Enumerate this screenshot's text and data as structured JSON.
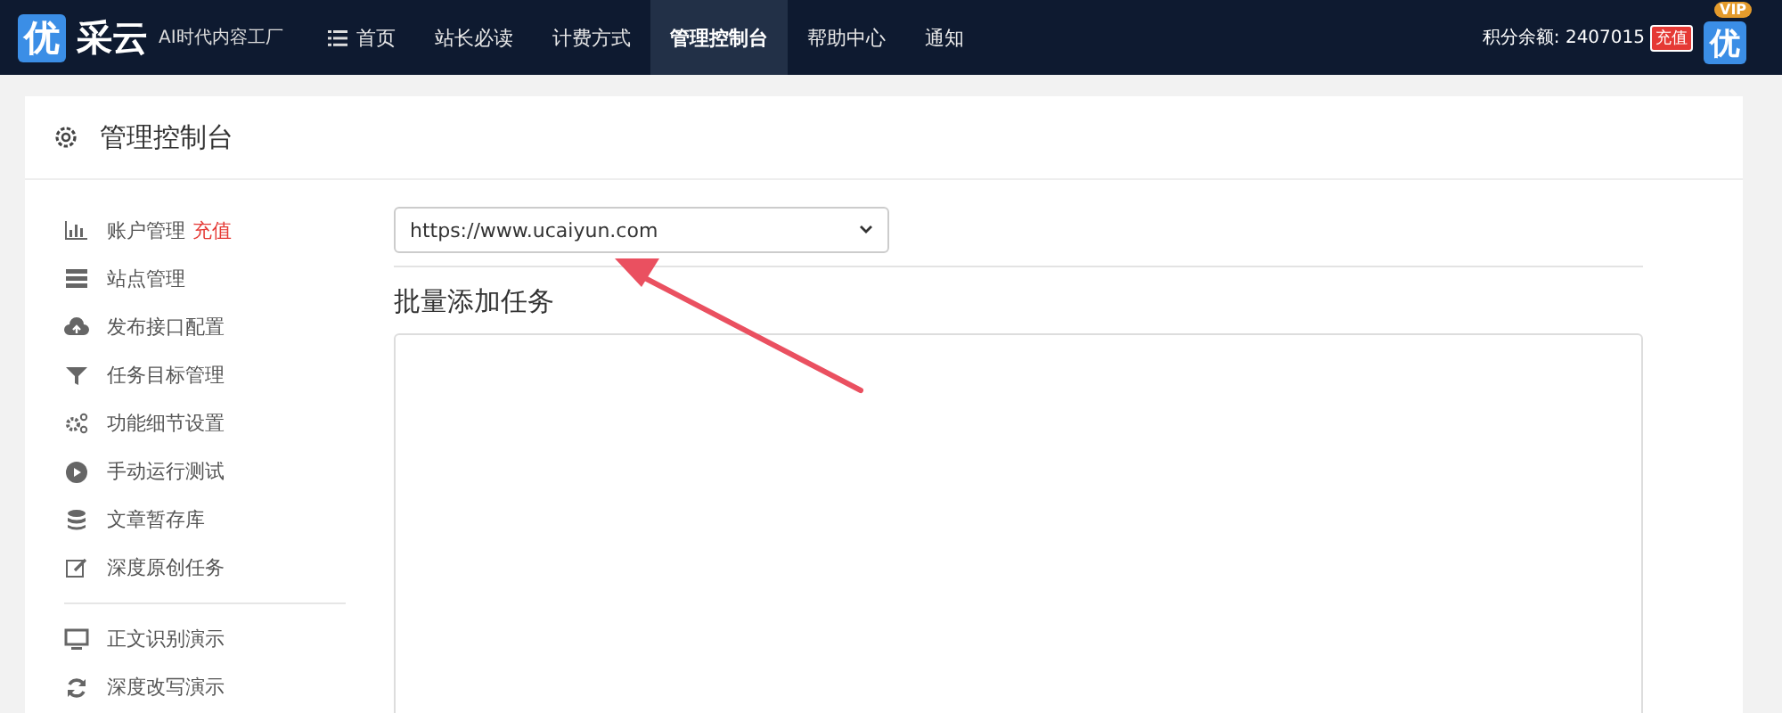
{
  "navbar": {
    "logo_mark": "优",
    "logo_text": "采云",
    "tagline": "AI时代内容工厂",
    "items": [
      {
        "label": "首页",
        "selected": false
      },
      {
        "label": "站长必读",
        "selected": false
      },
      {
        "label": "计费方式",
        "selected": false
      },
      {
        "label": "管理控制台",
        "selected": true
      },
      {
        "label": "帮助中心",
        "selected": false
      },
      {
        "label": "通知",
        "selected": false
      }
    ],
    "balance": "积分余额: 2407015",
    "recharge": "充值",
    "avatar": "优",
    "avatar_badge": "VIP"
  },
  "panel": {
    "title": "管理控制台"
  },
  "sidebar": {
    "groups": [
      {
        "items": [
          {
            "label": "账户管理",
            "badge": "充值"
          },
          {
            "label": "站点管理"
          },
          {
            "label": "发布接口配置"
          },
          {
            "label": "任务目标管理"
          },
          {
            "label": "功能细节设置"
          },
          {
            "label": "手动运行测试"
          },
          {
            "label": "文章暂存库"
          },
          {
            "label": "深度原创任务"
          }
        ]
      },
      {
        "items": [
          {
            "label": "正文识别演示"
          },
          {
            "label": "深度改写演示"
          }
        ]
      }
    ]
  },
  "content": {
    "site_select": "https://www.ucaiyun.com",
    "section_title": "批量添加任务"
  }
}
